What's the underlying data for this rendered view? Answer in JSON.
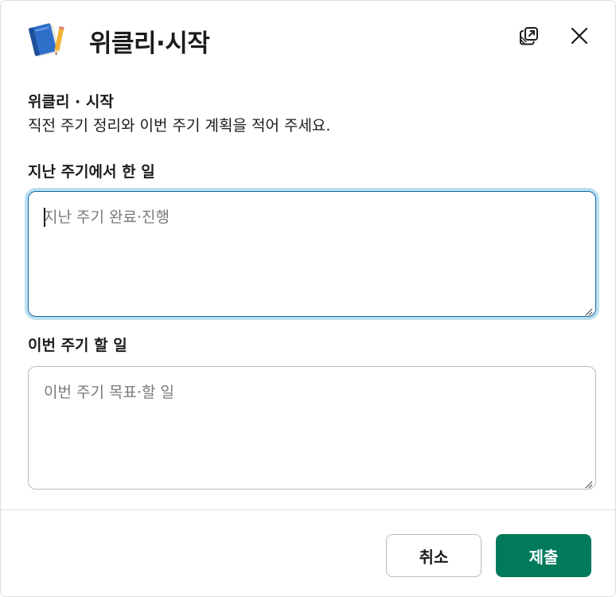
{
  "modal": {
    "title": "위클리·시작",
    "icon": "blue-notebook-with-pencil-icon"
  },
  "header_actions": {
    "popout_icon": "open-in-new-window-icon",
    "close_icon": "close-icon"
  },
  "section": {
    "title": "위클리 · 시작",
    "description": "직전 주기 정리와 이번 주기 계획을 적어 주세요."
  },
  "fields": [
    {
      "label": "지난 주기에서 한 일",
      "placeholder": "지난 주기 완료·진행",
      "value": "",
      "focused": true
    },
    {
      "label": "이번 주기 할 일",
      "placeholder": "이번 주기 목표·할 일",
      "value": "",
      "focused": false
    }
  ],
  "footer": {
    "cancel_label": "취소",
    "submit_label": "제출"
  },
  "colors": {
    "primary": "#007a5a",
    "focus_border": "#1264a3",
    "focus_ring": "#1d9bd1",
    "text": "#1d1c1d",
    "placeholder": "#7a7a7a",
    "border": "#bbbbbb"
  }
}
